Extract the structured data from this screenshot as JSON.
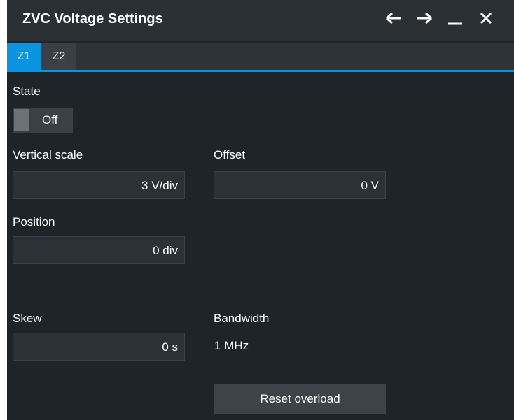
{
  "dialog": {
    "title": "ZVC Voltage Settings",
    "title_buttons": [
      {
        "name": "back",
        "icon": "arrow-left-icon"
      },
      {
        "name": "forward",
        "icon": "arrow-right-icon"
      },
      {
        "name": "minimize",
        "icon": "minimize-icon"
      },
      {
        "name": "close",
        "icon": "close-icon"
      }
    ]
  },
  "tabs": [
    {
      "label": "Z1",
      "active": true
    },
    {
      "label": "Z2",
      "active": false
    }
  ],
  "state": {
    "label": "State",
    "value": "Off"
  },
  "vertical_scale": {
    "label": "Vertical scale",
    "value": "3 V/div"
  },
  "offset": {
    "label": "Offset",
    "value": "0 V"
  },
  "position": {
    "label": "Position",
    "value": "0 div"
  },
  "skew": {
    "label": "Skew",
    "value": "0 s"
  },
  "bandwidth": {
    "label": "Bandwidth",
    "value": "1 MHz"
  },
  "reset_button": {
    "label": "Reset overload"
  },
  "colors": {
    "accent": "#0a93df",
    "background": "#1f2428",
    "titlebar": "#2b3034"
  }
}
